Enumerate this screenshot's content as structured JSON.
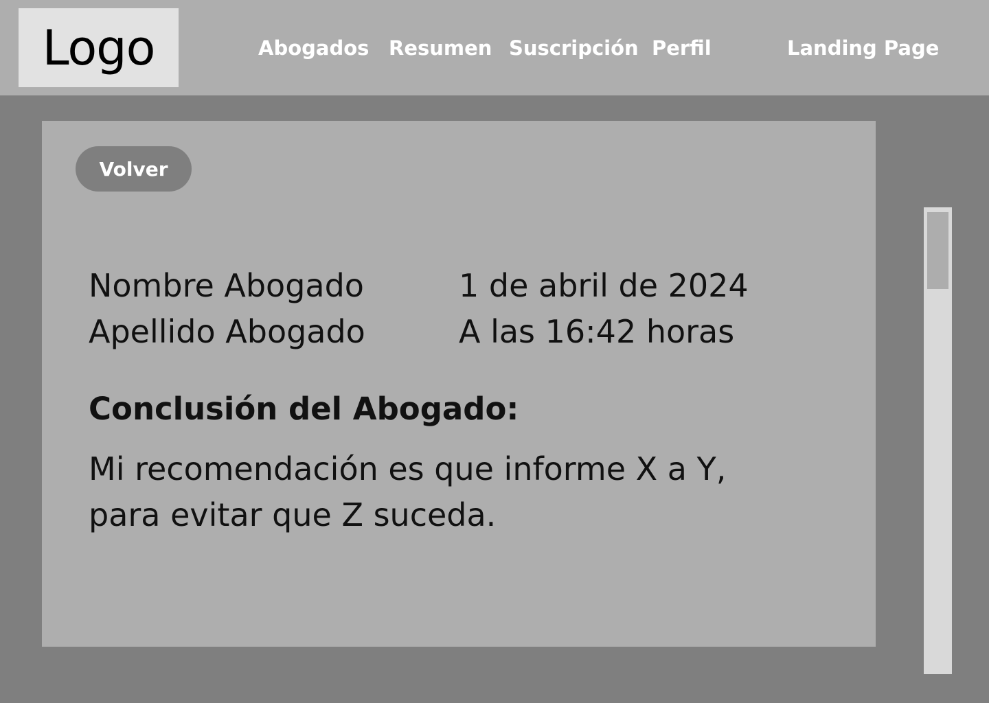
{
  "header": {
    "logo": "Logo",
    "nav": {
      "abogados": "Abogados",
      "resumen": "Resumen",
      "suscripcion": "Suscripción",
      "perfil": "Perfil",
      "landing_page": "Landing Page"
    }
  },
  "card": {
    "back_label": "Volver",
    "lawyer": {
      "first_name": "Nombre Abogado",
      "last_name": "Apellido Abogado"
    },
    "datetime": {
      "date": "1 de abril de 2024",
      "time": "A las 16:42 horas"
    },
    "conclusion": {
      "title": "Conclusión del Abogado:",
      "line1": "Mi recomendación es que informe X a Y,",
      "line2": "para evitar que Z suceda."
    }
  },
  "colors": {
    "background": "#7f7f7f",
    "header": "#aeaeae",
    "card": "#aeaeae",
    "logo_box": "#e2e2e2",
    "button": "#7f7f7f",
    "scroll_track": "#d9d9d9",
    "scroll_thumb": "#adadad"
  }
}
